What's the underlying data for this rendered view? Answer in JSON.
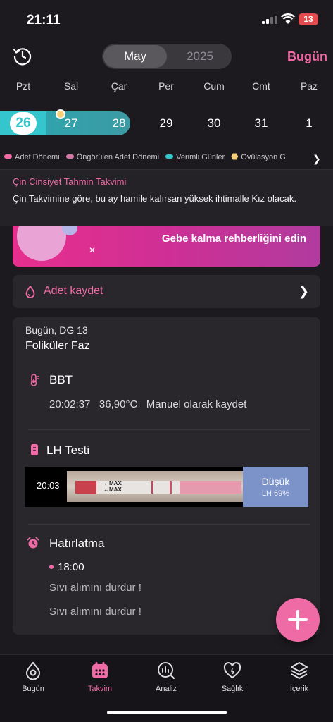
{
  "status_bar": {
    "time": "21:11",
    "battery": "13"
  },
  "header": {
    "month": "May",
    "year": "2025",
    "today_label": "Bugün"
  },
  "weekdays": [
    "Pzt",
    "Sal",
    "Çar",
    "Per",
    "Cum",
    "Cmt",
    "Paz"
  ],
  "days": [
    "26",
    "27",
    "28",
    "29",
    "30",
    "31",
    "1"
  ],
  "legend": [
    {
      "label": "Adet Dönemi",
      "color": "#ef6ba6"
    },
    {
      "label": "Öngörülen Adet Dönemi",
      "color": "#d477a6"
    },
    {
      "label": "Verimli Günler",
      "color": "#35c5cd"
    },
    {
      "label": "Ovülasyon G",
      "color": "#f4cf7b"
    }
  ],
  "banner": {
    "title": "Çin Cinsiyet Tahmin Takvimi",
    "text": "Çin Takvimine göre, bu ay hamile kalırsan yüksek ihtimalle Kız olacak."
  },
  "promo": {
    "text": "Gebe kalma rehberliğini edin"
  },
  "period": {
    "label": "Adet kaydet"
  },
  "day_card": {
    "header": "Bugün, DG 13",
    "phase": "Foliküler Faz",
    "bbt": {
      "title": "BBT",
      "time": "20:02:37",
      "value": "36,90°C",
      "source": "Manuel olarak kaydet"
    },
    "lh": {
      "title": "LH Testi",
      "time": "20:03",
      "result": "Düşük",
      "percent": "LH 69%"
    },
    "reminder": {
      "title": "Hatırlatma",
      "time": "18:00",
      "items": [
        "Sıvı alımını durdur !",
        "Sıvı alımını durdur !"
      ]
    }
  },
  "tabs": [
    {
      "label": "Bugün",
      "icon": "today-icon",
      "active": false
    },
    {
      "label": "Takvim",
      "icon": "calendar-icon",
      "active": true
    },
    {
      "label": "Analiz",
      "icon": "analysis-icon",
      "active": false
    },
    {
      "label": "Sağlık",
      "icon": "health-icon",
      "active": false
    },
    {
      "label": "İçerik",
      "icon": "content-icon",
      "active": false
    }
  ],
  "colors": {
    "accent": "#ef6ba6",
    "fertile": "#35c5cd",
    "lh_low": "#7b93c8"
  }
}
